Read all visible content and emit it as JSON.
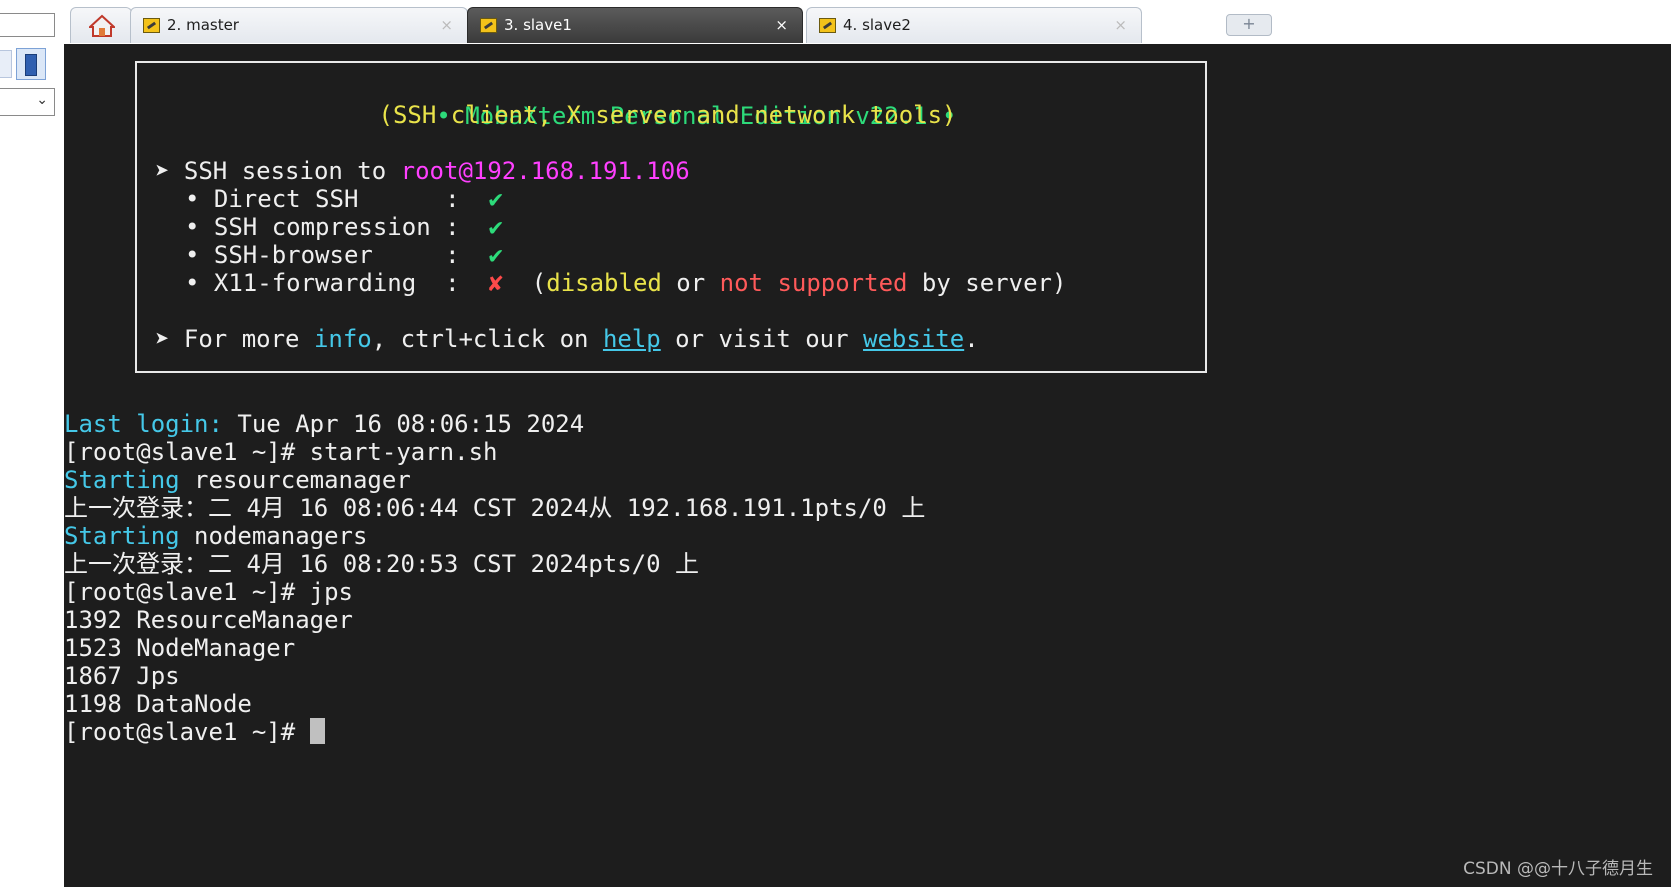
{
  "tabs": [
    {
      "label": "2. master",
      "close": "×"
    },
    {
      "label": "3. slave1",
      "close": "×"
    },
    {
      "label": "4. slave2",
      "close": "×"
    }
  ],
  "new_tab_symbol": "+",
  "left_panel": {
    "chevron": "⌄"
  },
  "banner": {
    "title": "• MobaXterm Personal Edition v22.1 •",
    "subtitle": "(SSH client, X server and network tools)",
    "session_arrow": "➤",
    "session_prefix": "SSH session to ",
    "session_target": "root@192.168.191.106",
    "features": [
      {
        "label": "• Direct SSH      :  ",
        "status": "✔"
      },
      {
        "label": "• SSH compression :  ",
        "status": "✔"
      },
      {
        "label": "• SSH-browser     :  ",
        "status": "✔"
      },
      {
        "label": "• X11-forwarding  :  ",
        "status": "✘"
      }
    ],
    "x11_note_open": "  (",
    "x11_disabled": "disabled",
    "x11_or": " or ",
    "x11_not_supported": "not supported",
    "x11_by_server": " by server)",
    "more_arrow": "➤",
    "more_prefix": "For more ",
    "more_info": "info",
    "more_mid": ", ctrl+click on ",
    "more_help": "help",
    "more_visit": " or visit our ",
    "more_website": "website",
    "more_end": "."
  },
  "terminal_lines": {
    "last_login_label": "Last login:",
    "last_login_value": " Tue Apr 16 08:06:15 2024",
    "cmd1": "[root@slave1 ~]# start-yarn.sh",
    "starting1_label": "Starting",
    "starting1_value": " resourcemanager",
    "login_msg1": "上一次登录：二 4月 16 08:06:44 CST 2024从 192.168.191.1pts/0 上",
    "starting2_label": "Starting",
    "starting2_value": " nodemanagers",
    "login_msg2": "上一次登录：二 4月 16 08:20:53 CST 2024pts/0 上",
    "cmd2": "[root@slave1 ~]# jps",
    "jps": [
      "1392 ResourceManager",
      "1523 NodeManager",
      "1867 Jps",
      "1198 DataNode"
    ],
    "prompt": "[root@slave1 ~]# "
  },
  "colors": {
    "terminal_bg": "#1d1d1d",
    "green": "#2ddb7a",
    "yellow": "#e9e34a",
    "magenta": "#ff40ff",
    "cyan": "#45c8e8",
    "red": "#ff5a5a"
  },
  "watermark": "CSDN @@十八子德月生"
}
